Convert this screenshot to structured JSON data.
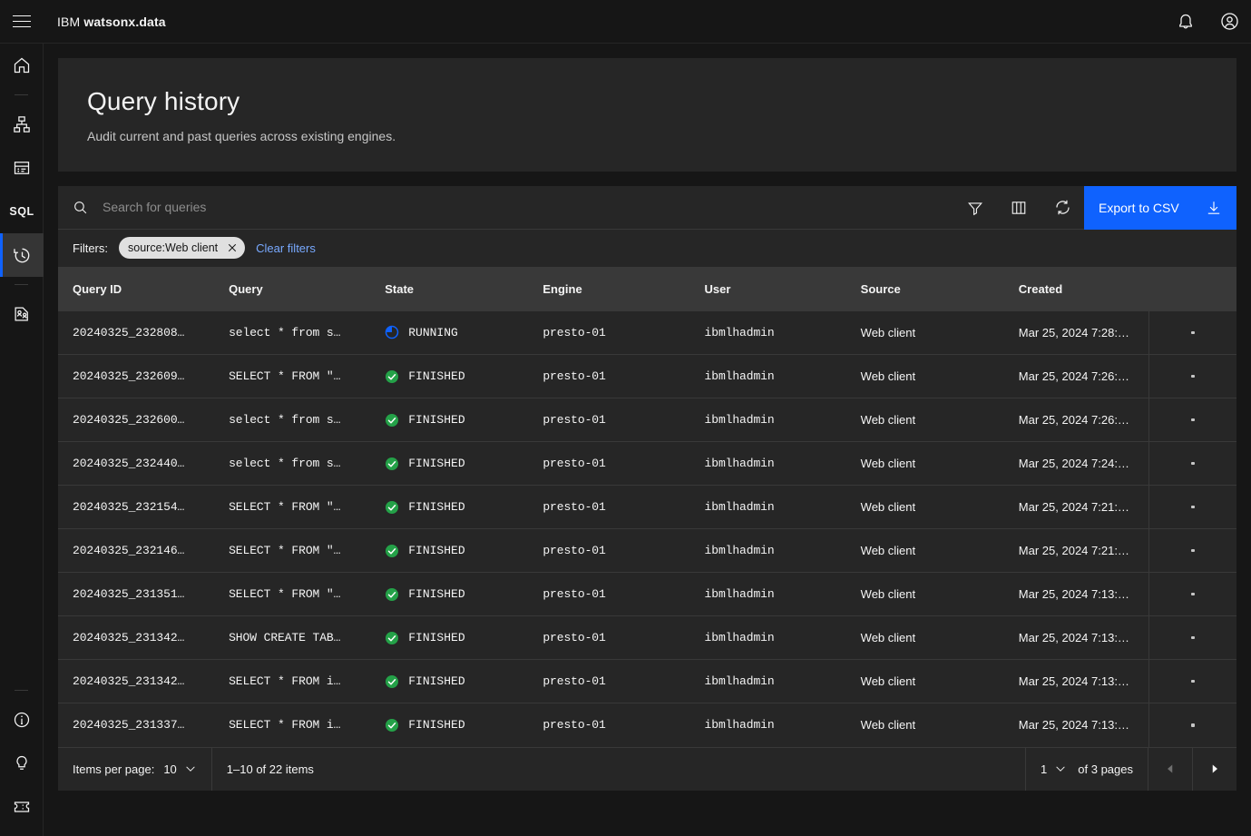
{
  "header": {
    "menu_icon": "hamburger-menu-icon",
    "brand_prefix": "IBM",
    "brand_name": "watsonx.data",
    "notifications_icon": "notification-bell-icon",
    "account_icon": "user-avatar-icon"
  },
  "sidebar": {
    "items": [
      {
        "name": "home",
        "icon": "home-icon",
        "label": "Home",
        "active": false
      },
      {
        "name": "infrastructure",
        "icon": "infrastructure-icon",
        "label": "Infrastructure manager",
        "active": false
      },
      {
        "name": "data-manager",
        "icon": "data-manager-icon",
        "label": "Data manager",
        "active": false
      },
      {
        "name": "sql",
        "icon": "sql-text-icon",
        "label": "SQL",
        "active": false
      },
      {
        "name": "query-history",
        "icon": "history-icon",
        "label": "Query history",
        "active": true
      },
      {
        "name": "access-control",
        "icon": "access-control-icon",
        "label": "Access control",
        "active": false
      }
    ],
    "bottom_items": [
      {
        "name": "about",
        "icon": "information-icon",
        "label": "About"
      },
      {
        "name": "whats-new",
        "icon": "lightbulb-icon",
        "label": "What's new"
      },
      {
        "name": "support",
        "icon": "ticket-icon",
        "label": "Support"
      }
    ]
  },
  "page": {
    "title": "Query history",
    "subtitle": "Audit current and past queries across existing engines."
  },
  "toolbar": {
    "search_placeholder": "Search for queries",
    "search_value": "",
    "search_icon": "search-icon",
    "filter_icon": "filter-icon",
    "columns_icon": "column-settings-icon",
    "refresh_icon": "refresh-icon",
    "export_label": "Export to CSV",
    "export_icon": "download-icon",
    "export_color": "#0f62fe"
  },
  "filters": {
    "label": "Filters:",
    "tags": [
      {
        "text": "source:Web client",
        "close_icon": "close-icon"
      }
    ],
    "clear_label": "Clear filters",
    "clear_color": "#78a9ff"
  },
  "table": {
    "columns": [
      "Query ID",
      "Query",
      "State",
      "Engine",
      "User",
      "Source",
      "Created"
    ],
    "row_menu_icon": "overflow-menu-icon",
    "state_colors": {
      "RUNNING": "#0f62fe",
      "FINISHED": "#24a148"
    },
    "rows": [
      {
        "query_id": "20240325_232808…",
        "query": "select * from s…",
        "state": "RUNNING",
        "state_icon": "in-progress-icon",
        "engine": "presto-01",
        "user": "ibmlhadmin",
        "source": "Web client",
        "created": "Mar 25, 2024 7:28:…"
      },
      {
        "query_id": "20240325_232609…",
        "query": "SELECT * FROM \"…",
        "state": "FINISHED",
        "state_icon": "checkmark-filled-icon",
        "engine": "presto-01",
        "user": "ibmlhadmin",
        "source": "Web client",
        "created": "Mar 25, 2024 7:26:…"
      },
      {
        "query_id": "20240325_232600…",
        "query": "select * from s…",
        "state": "FINISHED",
        "state_icon": "checkmark-filled-icon",
        "engine": "presto-01",
        "user": "ibmlhadmin",
        "source": "Web client",
        "created": "Mar 25, 2024 7:26:…"
      },
      {
        "query_id": "20240325_232440…",
        "query": "select * from s…",
        "state": "FINISHED",
        "state_icon": "checkmark-filled-icon",
        "engine": "presto-01",
        "user": "ibmlhadmin",
        "source": "Web client",
        "created": "Mar 25, 2024 7:24:…"
      },
      {
        "query_id": "20240325_232154…",
        "query": "SELECT * FROM \"…",
        "state": "FINISHED",
        "state_icon": "checkmark-filled-icon",
        "engine": "presto-01",
        "user": "ibmlhadmin",
        "source": "Web client",
        "created": "Mar 25, 2024 7:21:…"
      },
      {
        "query_id": "20240325_232146…",
        "query": "SELECT * FROM \"…",
        "state": "FINISHED",
        "state_icon": "checkmark-filled-icon",
        "engine": "presto-01",
        "user": "ibmlhadmin",
        "source": "Web client",
        "created": "Mar 25, 2024 7:21:…"
      },
      {
        "query_id": "20240325_231351…",
        "query": "SELECT * FROM \"…",
        "state": "FINISHED",
        "state_icon": "checkmark-filled-icon",
        "engine": "presto-01",
        "user": "ibmlhadmin",
        "source": "Web client",
        "created": "Mar 25, 2024 7:13:…"
      },
      {
        "query_id": "20240325_231342…",
        "query": "SHOW CREATE TAB…",
        "state": "FINISHED",
        "state_icon": "checkmark-filled-icon",
        "engine": "presto-01",
        "user": "ibmlhadmin",
        "source": "Web client",
        "created": "Mar 25, 2024 7:13:…"
      },
      {
        "query_id": "20240325_231342…",
        "query": "SELECT * FROM i…",
        "state": "FINISHED",
        "state_icon": "checkmark-filled-icon",
        "engine": "presto-01",
        "user": "ibmlhadmin",
        "source": "Web client",
        "created": "Mar 25, 2024 7:13:…"
      },
      {
        "query_id": "20240325_231337…",
        "query": "SELECT * FROM i…",
        "state": "FINISHED",
        "state_icon": "checkmark-filled-icon",
        "engine": "presto-01",
        "user": "ibmlhadmin",
        "source": "Web client",
        "created": "Mar 25, 2024 7:13:…"
      }
    ]
  },
  "pagination": {
    "items_per_page_label": "Items per page:",
    "items_per_page_value": "10",
    "range_text": "1–10 of 22 items",
    "page_value": "1",
    "pages_text": "of 3 pages",
    "prev_icon": "caret-left-icon",
    "next_icon": "caret-right-icon",
    "prev_disabled": true,
    "next_disabled": false
  }
}
